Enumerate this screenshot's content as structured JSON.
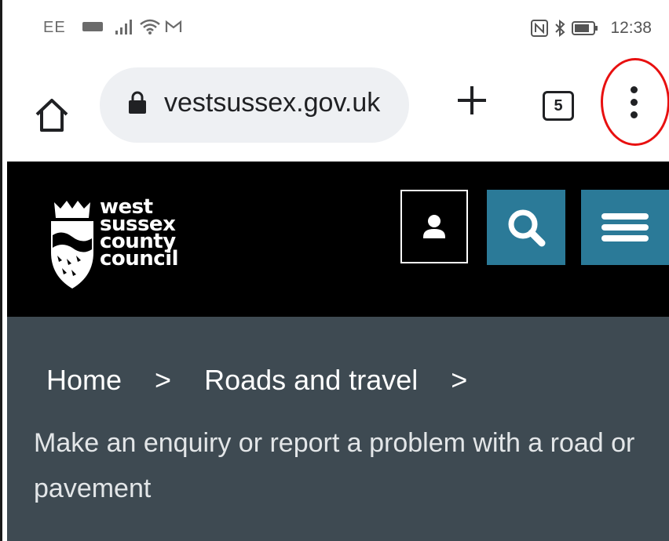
{
  "status_bar": {
    "carrier": "EE",
    "time": "12:38",
    "icons": [
      "volte-icon",
      "signal-icon",
      "wifi-icon",
      "gmail-icon",
      "nfc-icon",
      "bluetooth-icon",
      "battery-icon"
    ]
  },
  "browser": {
    "url": "vestsussex.gov.uk",
    "tab_count": "5",
    "buttons": [
      "home-icon",
      "new-tab-icon",
      "tab-switcher",
      "more-menu-icon"
    ],
    "highlight_color": "#e81010"
  },
  "site_header": {
    "logo_lines": [
      "west",
      "sussex",
      "county",
      "council"
    ],
    "button_color": "#2b7a98",
    "background": "#000000"
  },
  "breadcrumb": {
    "items": [
      "Home",
      "Roads and travel"
    ],
    "separator": ">",
    "current": "Make an enquiry or report a problem with a road or pavement",
    "background": "#3e4a52"
  }
}
